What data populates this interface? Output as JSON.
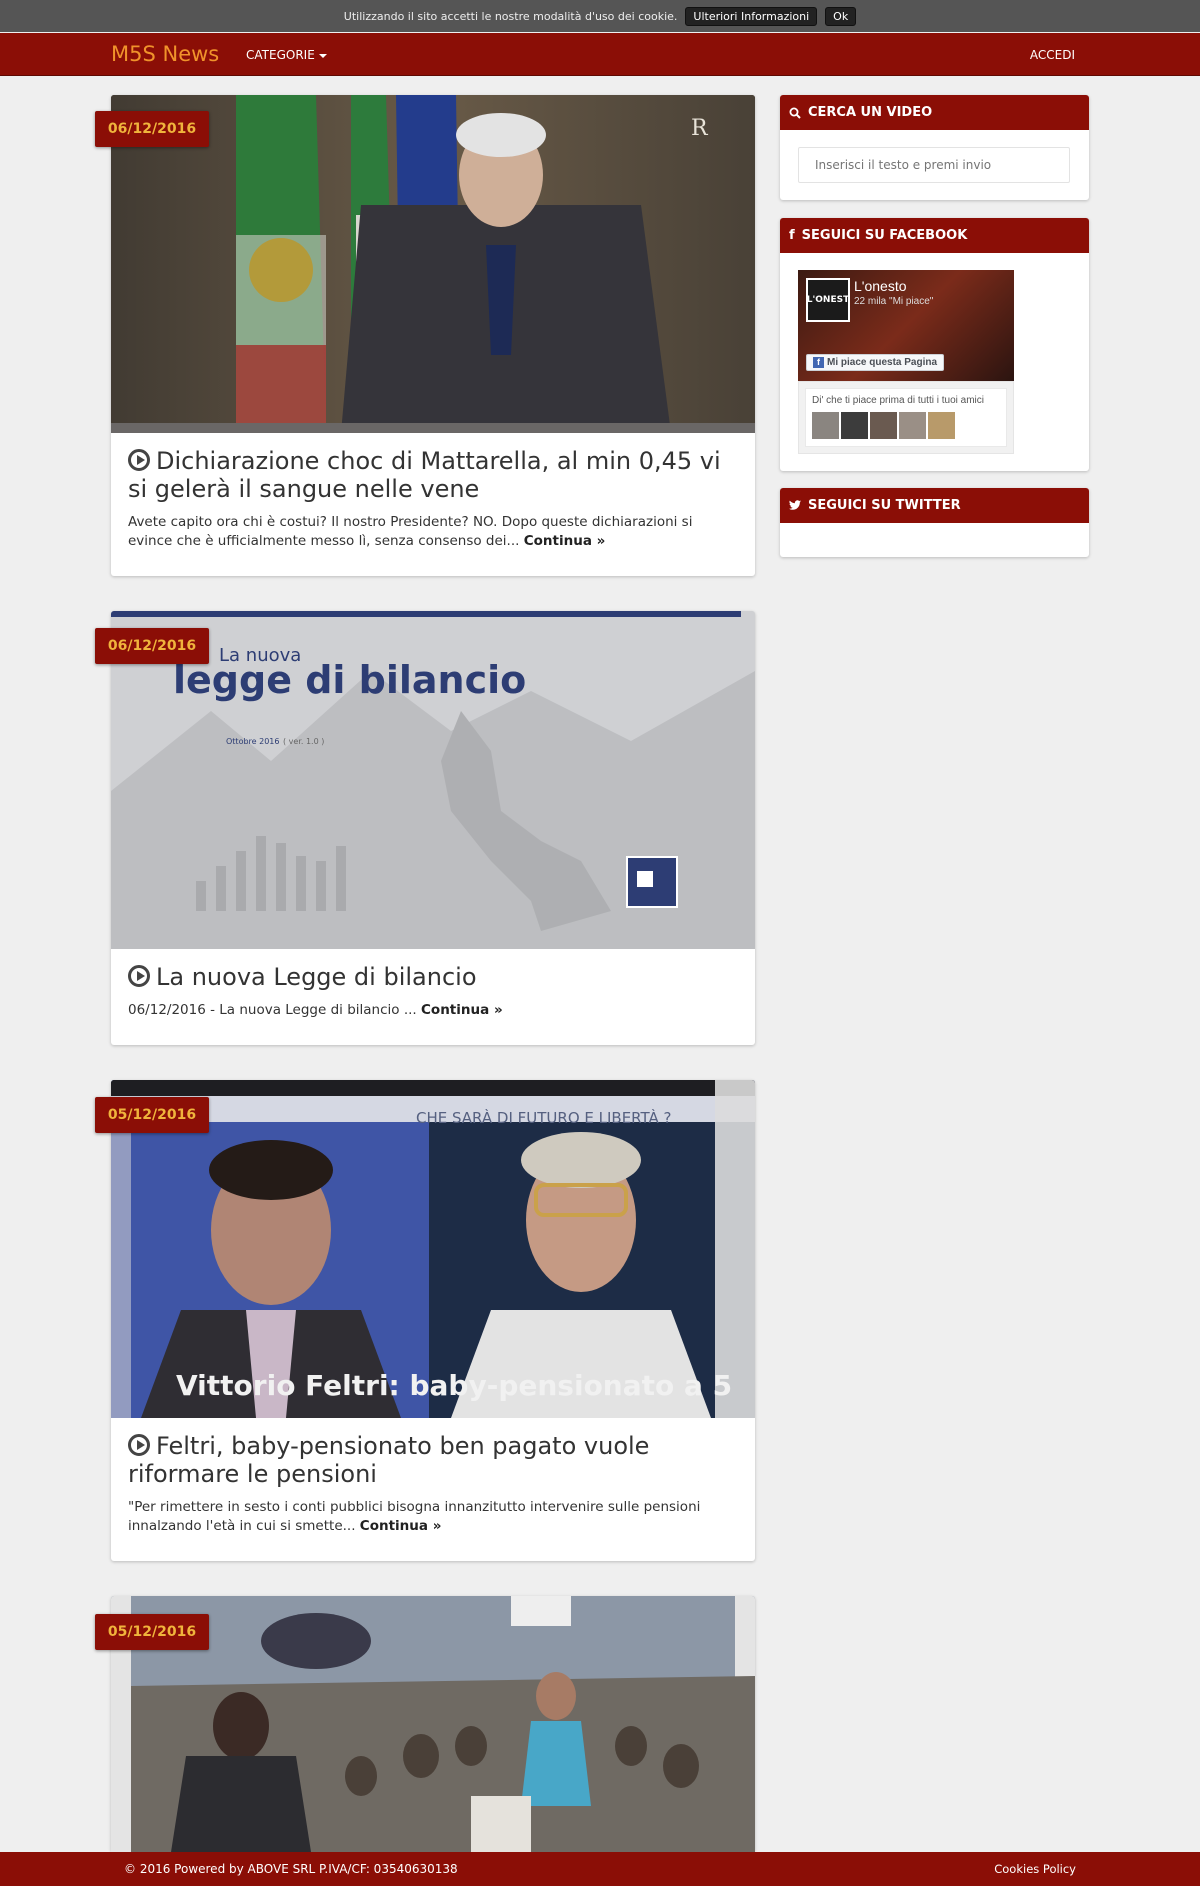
{
  "cookie": {
    "text": "Utilizzando il sito accetti le nostre modalità d'uso dei cookie.",
    "more_label": "Ulteriori Informazioni",
    "ok_label": "Ok"
  },
  "nav": {
    "brand": "M5S News",
    "categories": "CATEGORIE",
    "login": "ACCEDI"
  },
  "posts": [
    {
      "date": "06/12/2016",
      "title": "Dichiarazione choc di Mattarella, al min 0,45 vi si gelerà il sangue nelle vene",
      "excerpt": "Avete capito ora chi è costui? Il nostro Presidente? NO. Dopo queste dichiarazioni si evince che è ufficialmente messo lì, senza consenso dei...",
      "more": "Continua"
    },
    {
      "date": "06/12/2016",
      "title": "La nuova Legge di bilancio",
      "excerpt": "06/12/2016 - La nuova Legge di bilancio ...",
      "more": "Continua",
      "thumb_text": {
        "la_nuova": "La nuova",
        "headline": "legge di bilancio",
        "date": "Ottobre 2016",
        "version": "( ver. 1.0 )"
      }
    },
    {
      "date": "05/12/2016",
      "title": "Feltri, baby-pensionato ben pagato vuole riformare le pensioni",
      "excerpt": "\"Per rimettere in sesto i conti pubblici bisogna innanzitutto intervenire sulle pensioni innalzando l'età in cui si smette...",
      "more": "Continua",
      "thumb_text": {
        "top": "CHE SARÀ DI FUTURO E LIBERTÀ ?",
        "caption": "Vittorio Feltri: baby-pensionato a 5"
      }
    },
    {
      "date": "05/12/2016"
    }
  ],
  "sidebar": {
    "search": {
      "title": "CERCA UN VIDEO",
      "placeholder": "Inserisci il testo e premi invio"
    },
    "facebook": {
      "title": "SEGUICI SU FACEBOOK",
      "page_name": "L'onesto",
      "likes": "22 mila \"Mi piace\"",
      "like_button": "Mi piace questa Pagina",
      "friends_text": "Di' che ti piace prima di tutti i tuoi amici",
      "logo_text": "L'ONEST"
    },
    "twitter": {
      "title": "SEGUICI SU TWITTER"
    }
  },
  "footer": {
    "left": "© 2016 Powered by ABOVE SRL P.IVA/CF: 03540630138",
    "right": "Cookies Policy"
  },
  "colors": {
    "brand_red": "#8b0e06",
    "brand_orange": "#f0932b",
    "date_text": "#f0b43c"
  }
}
